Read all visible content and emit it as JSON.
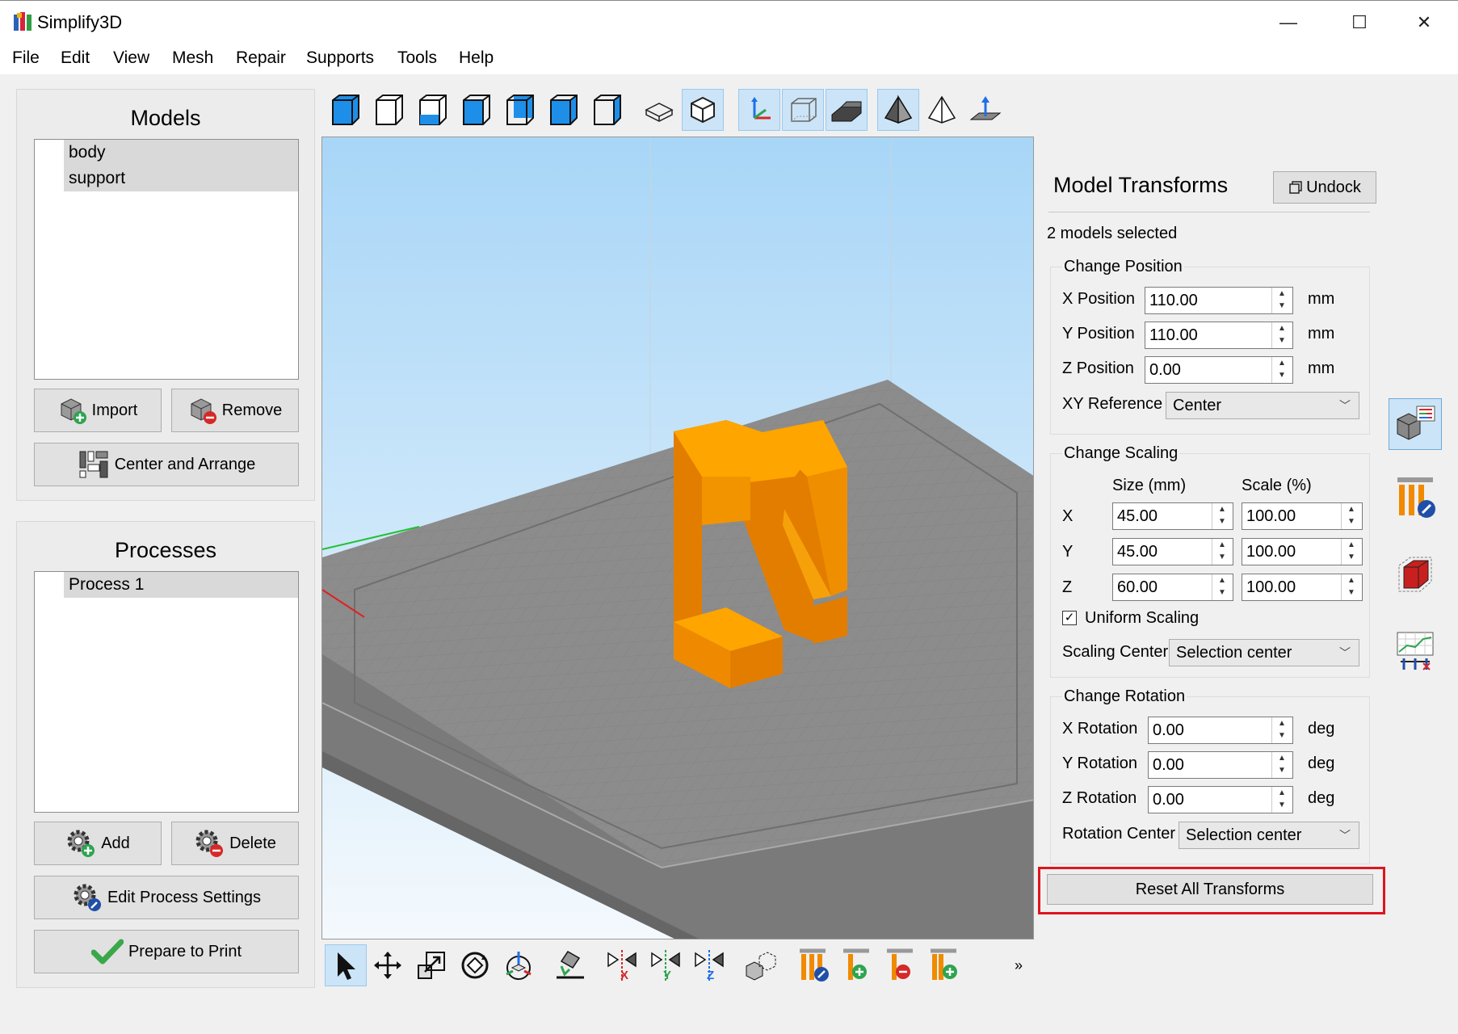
{
  "window": {
    "title": "Simplify3D",
    "minimize_glyph": "—",
    "maximize_glyph": "☐",
    "close_glyph": "✕"
  },
  "menu": [
    "File",
    "Edit",
    "View",
    "Mesh",
    "Repair",
    "Supports",
    "Tools",
    "Help"
  ],
  "models": {
    "title": "Models",
    "items": [
      "body",
      "support"
    ],
    "import_label": "Import",
    "remove_label": "Remove",
    "center_arrange_label": "Center and Arrange"
  },
  "processes": {
    "title": "Processes",
    "items": [
      "Process 1"
    ],
    "add_label": "Add",
    "delete_label": "Delete",
    "edit_label": "Edit Process Settings",
    "prepare_label": "Prepare to Print"
  },
  "transforms": {
    "title": "Model Transforms",
    "undock_label": "Undock",
    "selection_status": "2 models selected",
    "position": {
      "title": "Change Position",
      "x_label": "X Position",
      "x_value": "110.00",
      "y_label": "Y Position",
      "y_value": "110.00",
      "z_label": "Z Position",
      "z_value": "0.00",
      "unit": "mm",
      "xy_ref_label": "XY Reference",
      "xy_ref_value": "Center"
    },
    "scaling": {
      "title": "Change Scaling",
      "size_header": "Size (mm)",
      "scale_header": "Scale (%)",
      "x_label": "X",
      "x_size": "45.00",
      "x_scale": "100.00",
      "y_label": "Y",
      "y_size": "45.00",
      "y_scale": "100.00",
      "z_label": "Z",
      "z_size": "60.00",
      "z_scale": "100.00",
      "uniform_label": "Uniform Scaling",
      "uniform_checked": "✓",
      "center_label": "Scaling Center",
      "center_value": "Selection center"
    },
    "rotation": {
      "title": "Change Rotation",
      "x_label": "X Rotation",
      "x_value": "0.00",
      "y_label": "Y Rotation",
      "y_value": "0.00",
      "z_label": "Z Rotation",
      "z_value": "0.00",
      "unit": "deg",
      "center_label": "Rotation Center",
      "center_value": "Selection center"
    },
    "reset_label": "Reset All Transforms"
  },
  "bottom_toolbar": {
    "overflow_glyph": "»"
  },
  "colors": {
    "accent_blue": "#1e8fe8",
    "model_orange": "#ffa500",
    "highlight_red": "#e0141e",
    "viewport_sky_top": "#a8d6f7",
    "bed_gray": "#8c8c8c"
  },
  "icons": {
    "top_toolbar": [
      "view-default-icon",
      "view-front-icon",
      "view-back-icon",
      "view-left-icon",
      "view-right-icon",
      "view-top-icon",
      "view-bottom-icon",
      "wireframe-icon",
      "solid-icon",
      "axes-icon",
      "build-volume-icon",
      "bed-icon",
      "shaded-icon",
      "outline-icon",
      "ground-icon"
    ],
    "bottom_toolbar": [
      "select-icon",
      "move-icon",
      "scale-icon",
      "rotate-icon",
      "transform-icon",
      "place-on-bed-icon",
      "mirror-x-icon",
      "mirror-y-icon",
      "mirror-z-icon",
      "group-icon",
      "support-edit-icon",
      "support-add-icon",
      "support-remove-icon",
      "support-add-manual-icon"
    ],
    "side": [
      "model-transforms-icon",
      "support-settings-icon",
      "cross-section-icon",
      "preview-stats-icon"
    ]
  }
}
